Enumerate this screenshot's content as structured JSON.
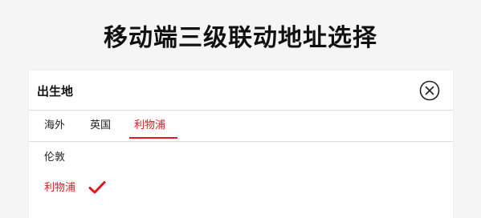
{
  "page": {
    "title": "移动端三级联动地址选择"
  },
  "panel": {
    "title": "出生地",
    "close_icon": "close-circle-icon"
  },
  "tabs": [
    {
      "label": "海外",
      "active": false
    },
    {
      "label": "英国",
      "active": false
    },
    {
      "label": "利物浦",
      "active": true
    }
  ],
  "options": [
    {
      "label": "伦敦",
      "selected": false
    },
    {
      "label": "利物浦",
      "selected": true,
      "icon": "check-icon"
    }
  ],
  "colors": {
    "accent": "#e3171c",
    "text": "#222222",
    "divider": "#dcdcdc"
  }
}
